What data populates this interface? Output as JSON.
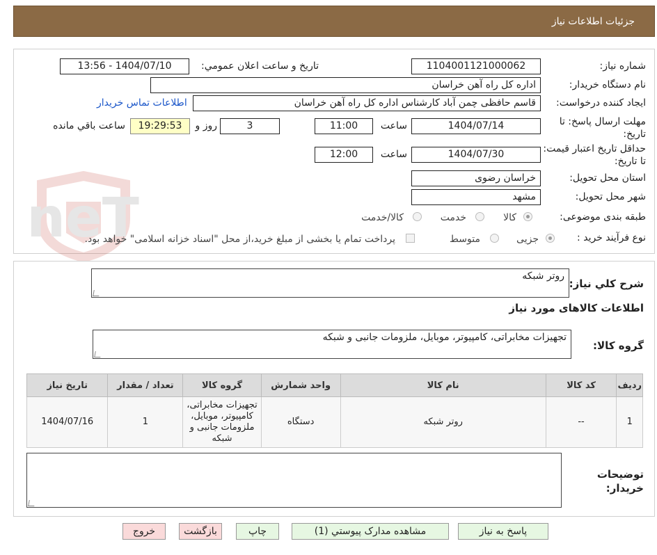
{
  "header": {
    "title": "جزئیات اطلاعات نیاز"
  },
  "form": {
    "need_number_label": "شماره نیاز:",
    "need_number": "1104001121000062",
    "announce_label": "تاریخ و ساعت اعلان عمومي:",
    "announce_value": "1404/07/10 - 13:56",
    "buyer_org_label": "نام دستگاه خریدار:",
    "buyer_org": "اداره کل راه آهن خراسان",
    "requester_label": "ایجاد کننده درخواست:",
    "requester": "قاسم حافظی چمن آباد کارشناس اداره کل راه آهن خراسان",
    "contact_link": "اطلاعات تماس خریدار",
    "deadline_label": "مهلت ارسال پاسخ: تا تاریخ:",
    "deadline_date": "1404/07/14",
    "time_label": "ساعت",
    "deadline_time": "11:00",
    "days_value": "3",
    "days_label": "روز و",
    "remaining_time": "19:29:53",
    "remaining_label": "ساعت باقي مانده",
    "validity_label": "حداقل تاریخ اعتبار قیمت: تا تاریخ:",
    "validity_date": "1404/07/30",
    "validity_time": "12:00",
    "province_label": "استان محل تحویل:",
    "province": "خراسان رضوی",
    "city_label": "شهر محل تحویل:",
    "city": "مشهد",
    "category_label": "طبقه بندی موضوعی:",
    "category_options": [
      "کالا",
      "خدمت",
      "کالا/خدمت"
    ],
    "category_selected": "کالا",
    "process_label": "نوع فرآیند خرید :",
    "process_options": [
      "جزیی",
      "متوسط"
    ],
    "process_selected": "جزیی",
    "payment_note": "پرداخت تمام یا بخشی از مبلغ خرید،از محل \"اسناد خزانه اسلامی\" خواهد بود."
  },
  "description": {
    "general_label": "شرح كلي نياز:",
    "general_value": "روتر شبکه",
    "goods_info_title": "اطلاعات کالاهای مورد نیاز",
    "group_label": "گروه کالا:",
    "group_value": "تجهیزات مخابراتی، کامپیوتر، موبایل، ملزومات جانبی و شبکه"
  },
  "table": {
    "headers": [
      "ردیف",
      "کد کالا",
      "نام کالا",
      "واحد شمارش",
      "گروه کالا",
      "تعداد / مقدار",
      "تاریخ نیاز"
    ],
    "rows": [
      {
        "row": "1",
        "code": "--",
        "name": "روتر شبکه",
        "unit": "دستگاه",
        "group": "تجهیزات مخابراتی، کامپیوتر، موبایل، ملزومات جانبی و شبکه",
        "qty": "1",
        "date": "1404/07/16"
      }
    ]
  },
  "buyer_notes": {
    "label": "توضیحات خریدار:",
    "value": ""
  },
  "buttons": {
    "reply": "پاسخ به نیاز",
    "attachments": "مشاهده مدارک پیوستي (1)",
    "print": "چاپ",
    "back": "بازگشت",
    "exit": "خروج"
  },
  "watermark": "AriaTender.neT",
  "colors": {
    "header_bg": "#8b6a45",
    "link": "#1a56c9",
    "remaining_bg": "#ffffc6",
    "button_green": "#e6f7e2",
    "button_pink": "#fadada"
  }
}
